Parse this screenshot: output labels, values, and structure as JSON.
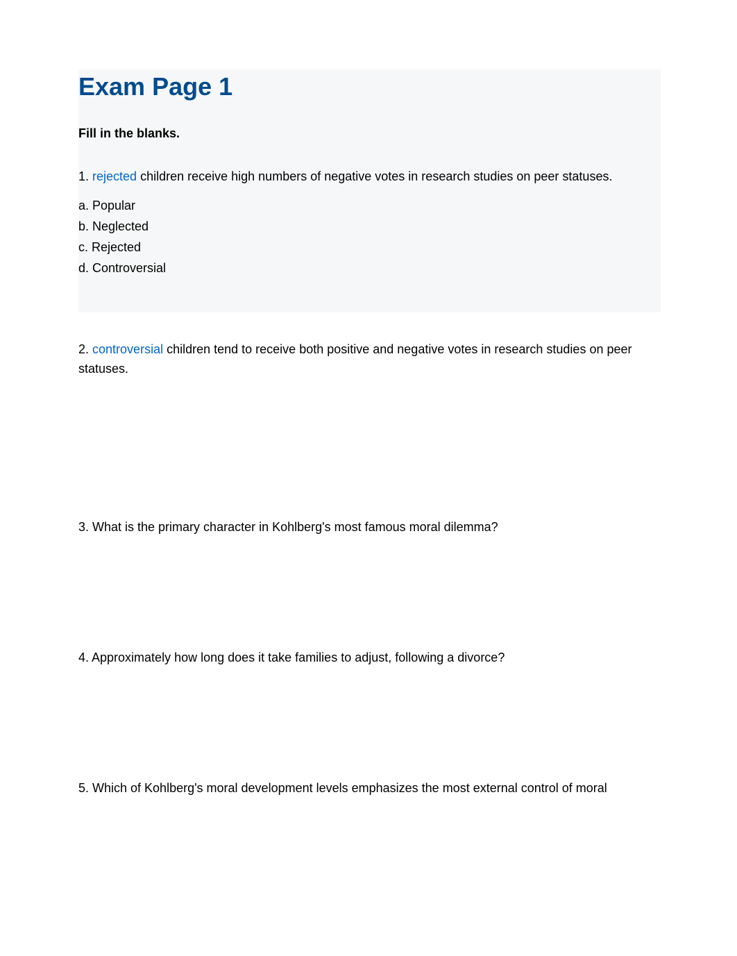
{
  "title": "Exam Page 1",
  "instruction": "Fill in the blanks.",
  "questions": {
    "q1": {
      "number": "1.",
      "answer": "rejected",
      "text_after": " children receive high numbers of negative votes in research studies on peer statuses.",
      "options": {
        "a": "a. Popular",
        "b": "b. Neglected",
        "c": "c. Rejected",
        "d": "d. Controversial"
      }
    },
    "q2": {
      "number": "2.",
      "answer": "controversial",
      "text_after": " children tend to receive both positive and negative votes in research studies on peer statuses."
    },
    "q3": {
      "text": "3. What is the primary character in Kohlberg's most famous moral dilemma?"
    },
    "q4": {
      "text": "4. Approximately how long does it take families to adjust, following a divorce?"
    },
    "q5": {
      "text": "5. Which of Kohlberg's moral development levels emphasizes the most external control of moral"
    }
  }
}
